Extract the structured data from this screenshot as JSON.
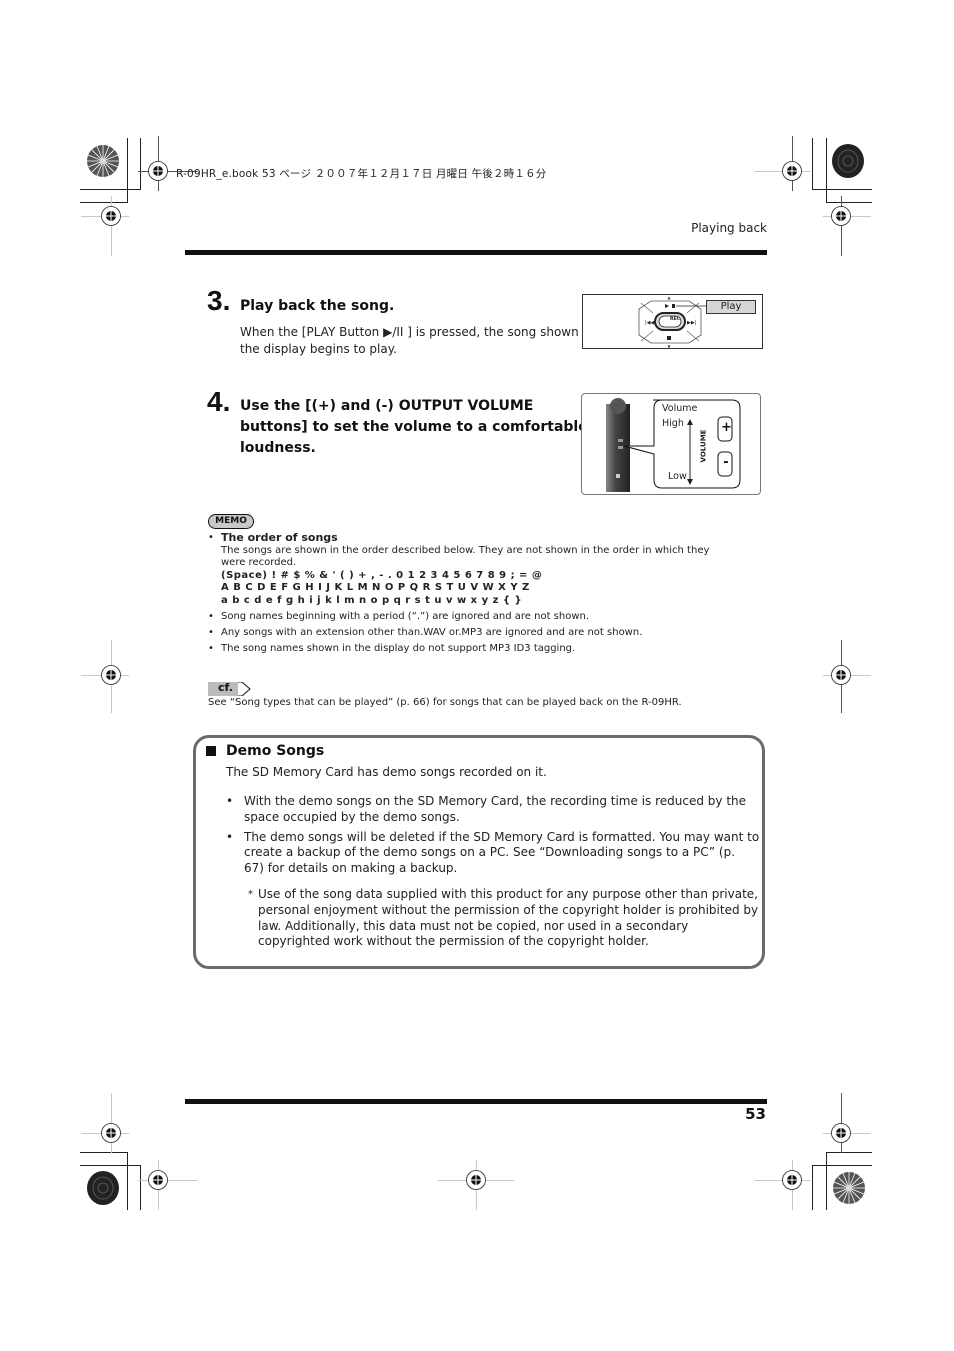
{
  "file_header": "R-09HR_e.book  53 ページ  ２００７年１２月１７日  月曜日  午後２時１６分",
  "running_head": "Playing back",
  "page_number": "53",
  "steps": [
    {
      "number": "3.",
      "title": "Play back the song.",
      "body_line1": "When the [PLAY Button ▶/II ] is pressed, the song shown in",
      "body_line2": "the display begins to play.",
      "figure": {
        "callout_label": "Play",
        "rec_label": "REC"
      }
    },
    {
      "number": "4.",
      "title_line1": "Use the [(+) and (-) OUTPUT VOLUME",
      "title_line2": "buttons] to set the volume to a comfortable",
      "title_line3": "loudness.",
      "figure": {
        "label_volume": "Volume",
        "label_high": "High",
        "label_low": "Low",
        "label_vertical": "VOLUME",
        "plus_label": "+",
        "minus_label": "-"
      }
    }
  ],
  "memo": {
    "badge": "MEMO",
    "items": [
      {
        "heading": "The order of songs",
        "lines": [
          "The songs are shown in the order described below. They are not shown in the order in which they",
          "were recorded."
        ],
        "char_rows": [
          "(Space) ! # $ % & ' ( ) + , - . 0 1 2 3 4 5 6 7 8 9 ; = @",
          "A B C D E F G H I J K L M N O P Q R S T U V W X Y Z",
          "a b c d e f g h i j k l m n o p q r s t u v w x y z { }"
        ]
      },
      {
        "text": "Song names beginning with a period (“.”) are ignored and are not shown."
      },
      {
        "text": "Any songs with an extension other than.WAV or.MP3 are ignored and are not shown."
      },
      {
        "text": "The song names shown in the display do not support MP3 ID3 tagging."
      }
    ]
  },
  "cf": {
    "badge": "cf.",
    "text": "See “Song types that can be played” (p. 66) for songs that can be played back on the R-09HR."
  },
  "demo_songs": {
    "title": "Demo Songs",
    "intro": "The SD Memory Card has demo songs recorded on it.",
    "bullets": [
      {
        "line1": "With the demo songs on the SD Memory Card, the recording time is reduced by the",
        "line2": "space occupied by the demo songs."
      },
      {
        "line1": "The demo songs will be deleted if the SD Memory Card is formatted. You may want to",
        "line2": "create a backup of the demo songs on a PC. See “Downloading songs to a PC” (p.",
        "line3": "67) for details on making a backup."
      }
    ],
    "note": {
      "mark": "*",
      "line1": "Use of the song data supplied with this product for any purpose other than private,",
      "line2": "personal enjoyment without the permission of the copyright holder is prohibited by",
      "line3": "law. Additionally, this data must not be copied, nor used in a secondary",
      "line4": "copyrighted work without the permission of the copyright holder."
    }
  }
}
